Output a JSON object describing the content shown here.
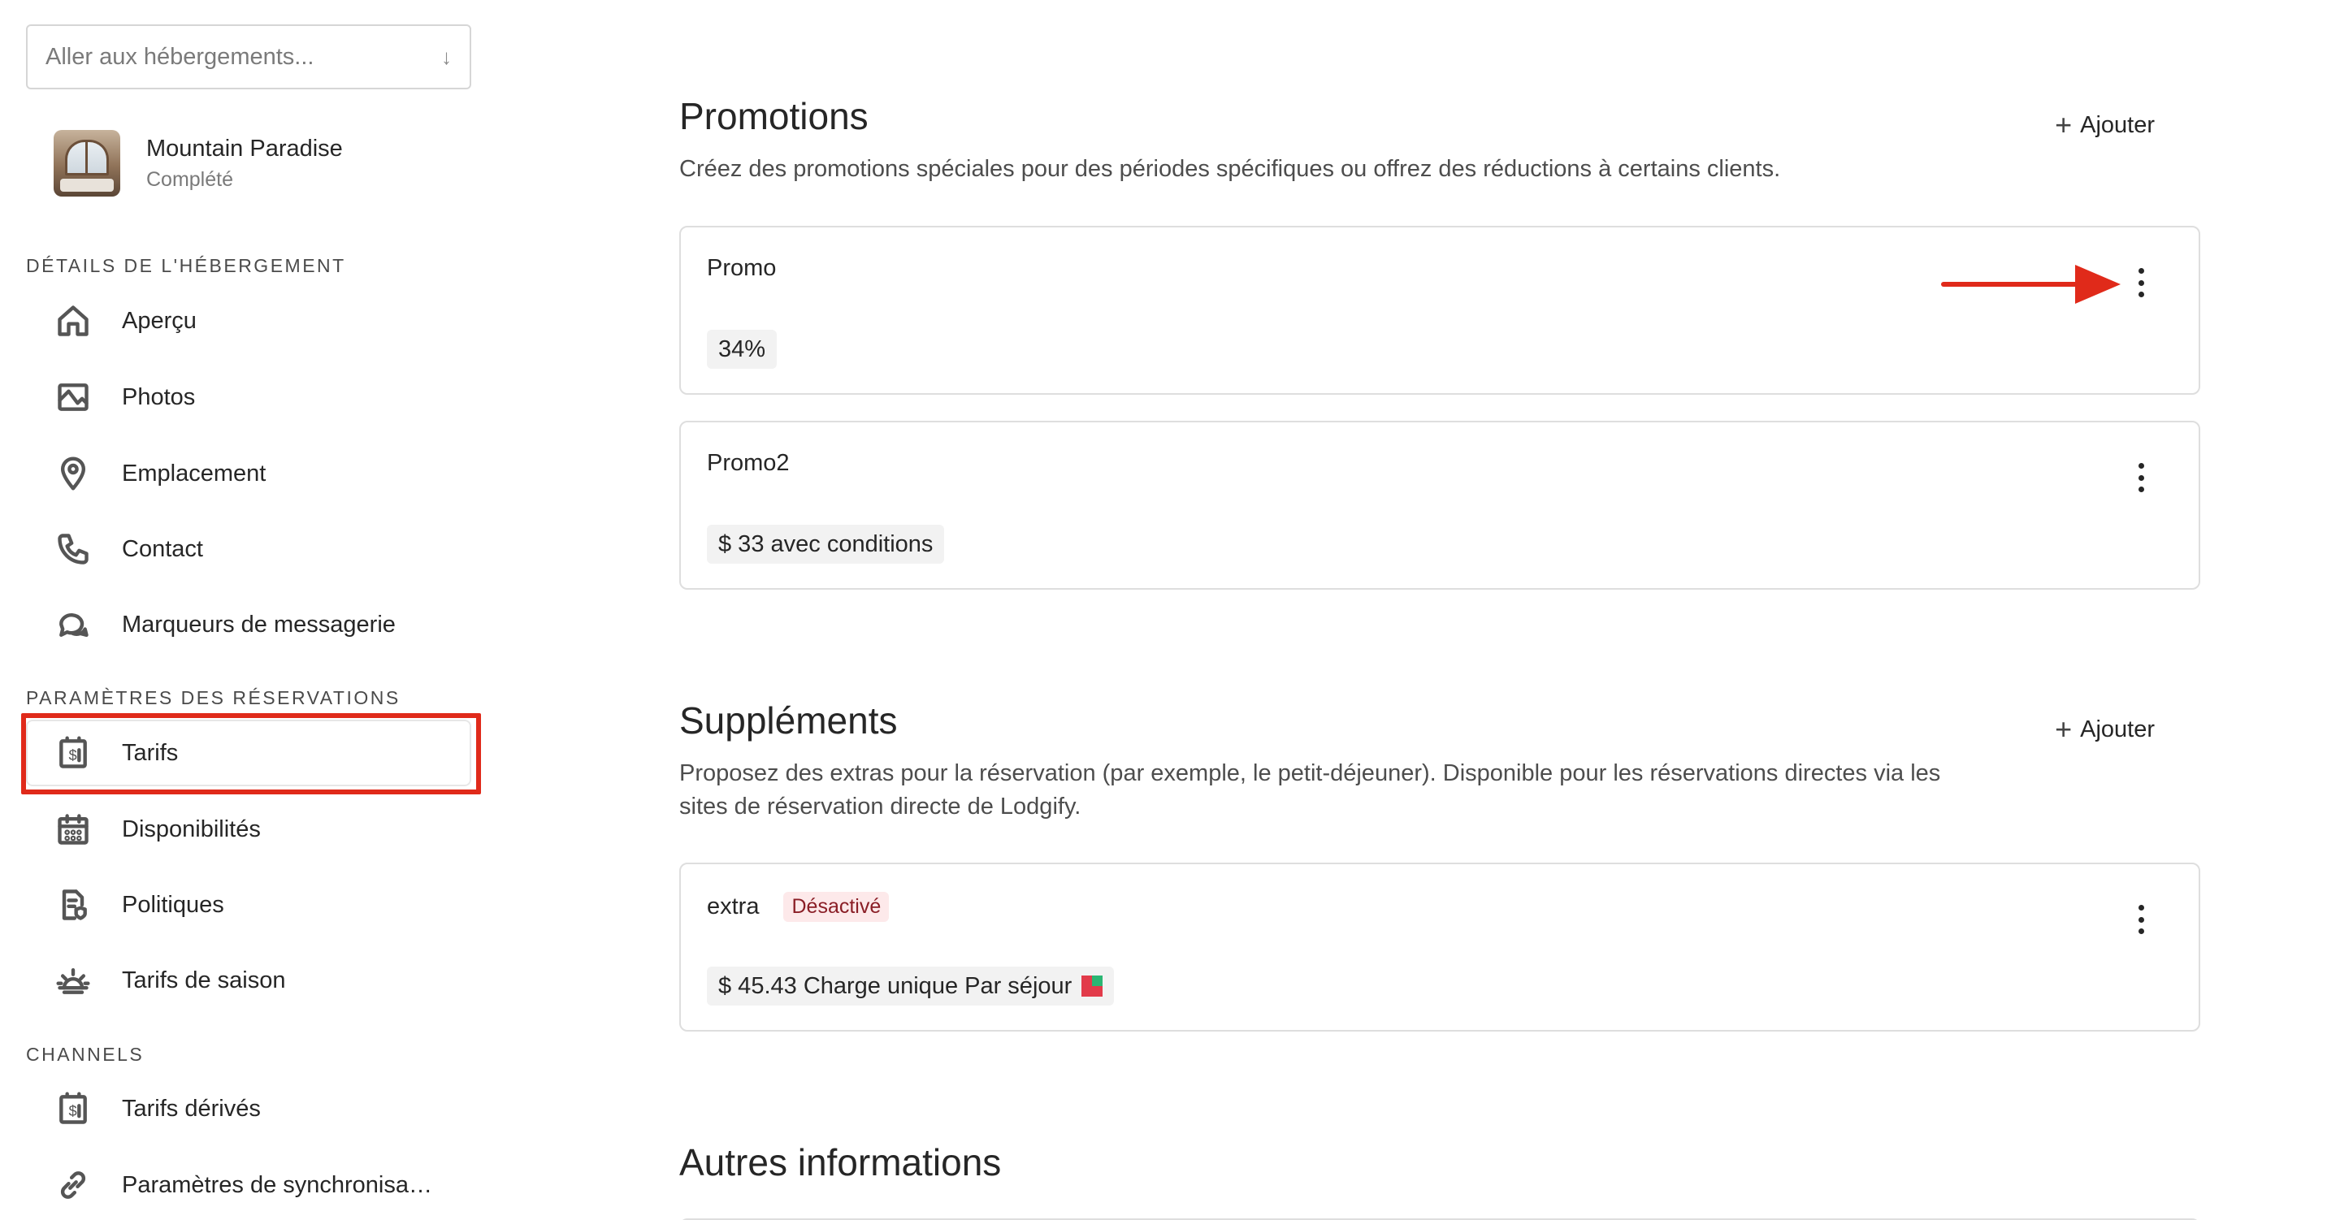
{
  "sidebar": {
    "property_select_placeholder": "Aller aux hébergements...",
    "property": {
      "name": "Mountain Paradise",
      "status": "Complété"
    },
    "sections": {
      "details": "DÉTAILS DE L'HÉBERGEMENT",
      "reservations": "PARAMÈTRES DES RÉSERVATIONS",
      "channels": "CHANNELS"
    },
    "items": [
      {
        "label": "Aperçu",
        "icon": "home-icon"
      },
      {
        "label": "Photos",
        "icon": "image-icon"
      },
      {
        "label": "Emplacement",
        "icon": "location-pin-icon"
      },
      {
        "label": "Contact",
        "icon": "phone-icon"
      },
      {
        "label": "Marqueurs de messagerie",
        "icon": "chat-bubbles-icon"
      },
      {
        "label": "Tarifs",
        "icon": "price-tag-icon",
        "active": true
      },
      {
        "label": "Disponibilités",
        "icon": "calendar-icon"
      },
      {
        "label": "Politiques",
        "icon": "policy-document-icon"
      },
      {
        "label": "Tarifs de saison",
        "icon": "sun-icon"
      },
      {
        "label": "Tarifs dérivés",
        "icon": "price-tag-icon"
      },
      {
        "label": "Paramètres de synchronisa…",
        "icon": "link-icon"
      }
    ]
  },
  "main": {
    "promotions": {
      "title": "Promotions",
      "add_label": "Ajouter",
      "description": "Créez des promotions spéciales pour des périodes spécifiques ou offrez des réductions à certains clients.",
      "cards": [
        {
          "title": "Promo",
          "chip": "34%"
        },
        {
          "title": "Promo2",
          "chip": "$ 33 avec conditions"
        }
      ]
    },
    "supplements": {
      "title": "Suppléments",
      "add_label": "Ajouter",
      "description_line1": "Proposez des extras pour la réservation (par exemple, le petit-déjeuner). Disponible pour les réservations directes via les",
      "description_line2": "sites de réservation directe de Lodgify.",
      "cards": [
        {
          "title": "extra",
          "badge": "Désactivé",
          "chip": "$ 45.43 Charge unique Par séjour"
        }
      ]
    },
    "other": {
      "title": "Autres informations"
    }
  },
  "colors": {
    "highlight": "#e02a1a",
    "badge_bg": "#fde9ea",
    "badge_text": "#8a1e26"
  }
}
